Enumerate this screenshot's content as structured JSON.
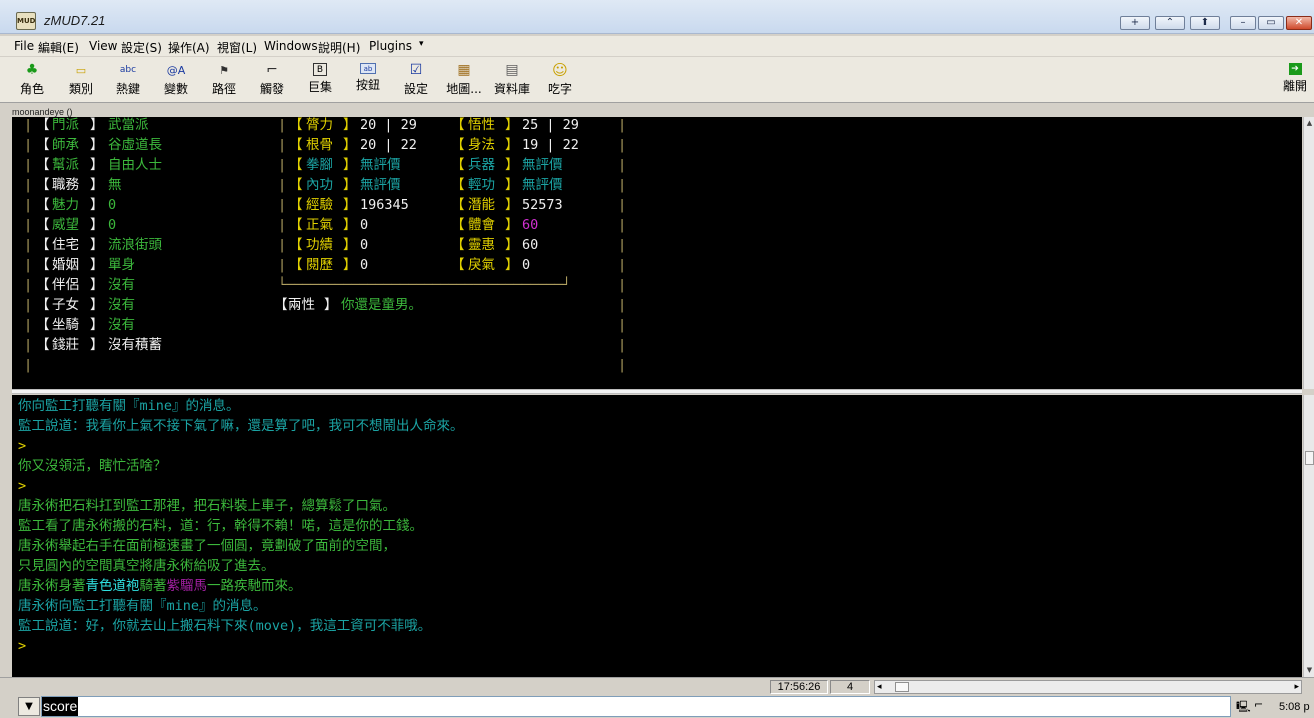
{
  "window": {
    "title": "zMUD7.21",
    "icon_text": "MUD",
    "buttons": [
      "+",
      "⌃",
      "⬆",
      "–",
      "▭",
      "✕"
    ]
  },
  "menu": [
    "File",
    "編輯(E)",
    "View",
    "設定(S)",
    "操作(A)",
    "視窗(L)",
    "Windows",
    "說明(H)",
    "Plugins"
  ],
  "toolbar": [
    {
      "label": "角色",
      "icon": "character-icon",
      "glyph": "♣"
    },
    {
      "label": "類別",
      "icon": "folder-icon",
      "glyph": "▭"
    },
    {
      "label": "熱鍵",
      "icon": "abc-icon",
      "glyph": "abc"
    },
    {
      "label": "變數",
      "icon": "variable-icon",
      "glyph": "@A"
    },
    {
      "label": "路徑",
      "icon": "path-icon",
      "glyph": "⚑"
    },
    {
      "label": "觸發",
      "icon": "trigger-gun-icon",
      "glyph": "⌐"
    },
    {
      "label": "巨集",
      "icon": "macro-icon",
      "glyph": "B"
    },
    {
      "label": "按鈕",
      "icon": "button-icon",
      "glyph": "ab"
    },
    {
      "label": "設定",
      "icon": "checkbox-icon",
      "glyph": "☑"
    },
    {
      "label": "地圖...",
      "icon": "map-icon",
      "glyph": "▦"
    },
    {
      "label": "資料庫",
      "icon": "database-icon",
      "glyph": "▤"
    },
    {
      "label": "吃字",
      "icon": "smiley-icon",
      "glyph": "☺"
    }
  ],
  "toolbar_right": {
    "label": "離開",
    "icon": "exit-icon",
    "glyph": "➔"
  },
  "session": {
    "label": "moonandeye ()"
  },
  "upper_left": [
    {
      "open": "【",
      "key": "門派",
      "close": "】",
      "value": "武當派",
      "kc": "c-green",
      "vc": "c-green",
      "bc": "c-white"
    },
    {
      "open": "【",
      "key": "師承",
      "close": "】",
      "value": "谷虛道長",
      "kc": "c-green",
      "vc": "c-green",
      "bc": "c-white"
    },
    {
      "open": "【",
      "key": "幫派",
      "close": "】",
      "value": "自由人士",
      "kc": "c-green",
      "vc": "c-green",
      "bc": "c-white"
    },
    {
      "open": "【",
      "key": "職務",
      "close": "】",
      "value": "無",
      "kc": "c-white",
      "vc": "c-green",
      "bc": "c-white"
    },
    {
      "open": "【",
      "key": "魅力",
      "close": "】",
      "value": "0",
      "kc": "c-green",
      "vc": "c-green",
      "bc": "c-white"
    },
    {
      "open": "【",
      "key": "威望",
      "close": "】",
      "value": "0",
      "kc": "c-green",
      "vc": "c-green",
      "bc": "c-white"
    },
    {
      "open": "【",
      "key": "住宅",
      "close": "】",
      "value": "流浪街頭",
      "kc": "c-white",
      "vc": "c-green",
      "bc": "c-white"
    },
    {
      "open": "【",
      "key": "婚姻",
      "close": "】",
      "value": "單身",
      "kc": "c-white",
      "vc": "c-green",
      "bc": "c-white"
    },
    {
      "open": "【",
      "key": "伴侶",
      "close": "】",
      "value": "沒有",
      "kc": "c-white",
      "vc": "c-green",
      "bc": "c-white"
    },
    {
      "open": "【",
      "key": "子女",
      "close": "】",
      "value": "沒有",
      "kc": "c-white",
      "vc": "c-green",
      "bc": "c-white"
    },
    {
      "open": "【",
      "key": "坐騎",
      "close": "】",
      "value": "沒有",
      "kc": "c-white",
      "vc": "c-green",
      "bc": "c-white"
    },
    {
      "open": "【",
      "key": "錢莊",
      "close": "】",
      "value": "沒有積蓄",
      "kc": "c-white",
      "vc": "c-white",
      "bc": "c-white"
    }
  ],
  "upper_mid": [
    {
      "key": "膂力",
      "value": "20 | 29",
      "kc": "c-yellow",
      "vc": "c-white"
    },
    {
      "key": "根骨",
      "value": "20 | 22",
      "kc": "c-yellow",
      "vc": "c-white"
    },
    {
      "key": "拳腳",
      "value": "無評價",
      "kc": "c-teal",
      "vc": "c-teal"
    },
    {
      "key": "內功",
      "value": "無評價",
      "kc": "c-teal",
      "vc": "c-teal"
    },
    {
      "key": "經驗",
      "value": "196345",
      "kc": "c-yellow",
      "vc": "c-white"
    },
    {
      "key": "正氣",
      "value": "0",
      "kc": "c-yellow",
      "vc": "c-white"
    },
    {
      "key": "功績",
      "value": "0",
      "kc": "c-yellow",
      "vc": "c-white"
    },
    {
      "key": "閱歷",
      "value": "0",
      "kc": "c-yellow",
      "vc": "c-white"
    }
  ],
  "upper_right": [
    {
      "key": "悟性",
      "value": "25 | 29",
      "kc": "c-yellow",
      "vc": "c-white"
    },
    {
      "key": "身法",
      "value": "19 | 22",
      "kc": "c-yellow",
      "vc": "c-white"
    },
    {
      "key": "兵器",
      "value": "無評價",
      "kc": "c-teal",
      "vc": "c-teal"
    },
    {
      "key": "輕功",
      "value": "無評價",
      "kc": "c-teal",
      "vc": "c-teal"
    },
    {
      "key": "潛能",
      "value": "52573",
      "kc": "c-yellow",
      "vc": "c-white"
    },
    {
      "key": "體會",
      "value": "60",
      "kc": "c-yellow",
      "vc": "c-magenta"
    },
    {
      "key": "靈惠",
      "value": "60",
      "kc": "c-yellow",
      "vc": "c-white"
    },
    {
      "key": "戾氣",
      "value": "0",
      "kc": "c-yellow",
      "vc": "c-white"
    }
  ],
  "gender": {
    "key": "兩性",
    "value": "你還是童男。"
  },
  "log": [
    {
      "segments": [
        {
          "t": "你向監工打聽有關『mine』的消息。",
          "c": "c-teal"
        }
      ]
    },
    {
      "segments": [
        {
          "t": "監工說道：我看你上氣不接下氣了嘛，還是算了吧，我可不想鬧出人命來。",
          "c": "c-teal"
        }
      ]
    },
    {
      "segments": [
        {
          "t": ">",
          "c": "c-yellow"
        }
      ]
    },
    {
      "segments": [
        {
          "t": "你又沒領活，瞎忙活啥？",
          "c": "c-green"
        }
      ]
    },
    {
      "segments": [
        {
          "t": ">",
          "c": "c-yellow"
        }
      ]
    },
    {
      "segments": [
        {
          "t": "唐永術把石料扛到監工那裡，把石料裝上車子，總算鬆了口氣。",
          "c": "c-green"
        }
      ]
    },
    {
      "segments": [
        {
          "t": "監工看了唐永術搬的石料，道：行，幹得不賴！喏，這是你的工錢。",
          "c": "c-green"
        }
      ]
    },
    {
      "segments": [
        {
          "t": "唐永術舉起右手在面前極速畫了一個圓，竟劃破了面前的空間，",
          "c": "c-green"
        }
      ]
    },
    {
      "segments": [
        {
          "t": "只見圓內的空間真空將唐永術給吸了進去。",
          "c": "c-green"
        }
      ]
    },
    {
      "segments": [
        {
          "t": "唐永術身著",
          "c": "c-green"
        },
        {
          "t": "青色道袍",
          "c": "c-cyan"
        },
        {
          "t": "騎著",
          "c": "c-green"
        },
        {
          "t": "紫騮馬",
          "c": "c-purple"
        },
        {
          "t": "一路疾馳而來。",
          "c": "c-green"
        }
      ]
    },
    {
      "segments": [
        {
          "t": "唐永術向監工打聽有關『mine』的消息。",
          "c": "c-teal"
        }
      ]
    },
    {
      "segments": [
        {
          "t": "監工說道：好，你就去山上搬石料下來(move)，我這工資可不菲哦。",
          "c": "c-teal"
        }
      ]
    },
    {
      "segments": [
        {
          "t": ">",
          "c": "c-yellow"
        }
      ]
    }
  ],
  "status": {
    "time": "17:56:26",
    "count": "4"
  },
  "command": {
    "value": "score"
  },
  "tray": {
    "time": "5:08 p"
  }
}
